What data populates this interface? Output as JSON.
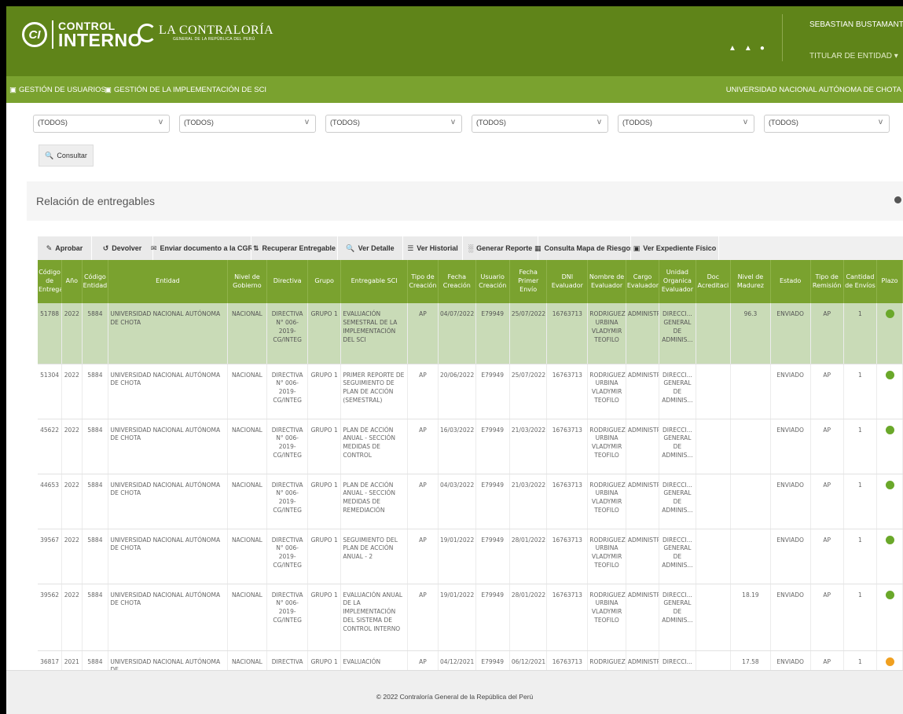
{
  "header": {
    "logo_ci_mark": "CI",
    "logo_line1": "CONTROL",
    "logo_line2": "INTERNO",
    "contraloria_name": "LA CONTRALORÍA",
    "contraloria_sub": "GENERAL DE LA REPÚBLICA DEL PERÚ",
    "user_name": "SEBASTIAN BUSTAMANTE EDQUEN",
    "user_role": "TITULAR DE ENTIDAD ▾",
    "icons": [
      "home-icon",
      "bell-icon",
      "user-icon"
    ]
  },
  "nav": {
    "gestion_usuarios": "GESTIÓN DE USUARIOS",
    "gestion_implementacion": "GESTIÓN DE LA IMPLEMENTACIÓN DE SCI",
    "entity": "UNIVERSIDAD NACIONAL AUTÓNOMA DE CHOTA"
  },
  "filters": [
    {
      "value": "(TODOS)"
    },
    {
      "value": "(TODOS)"
    },
    {
      "value": "(TODOS)"
    },
    {
      "value": "(TODOS)"
    },
    {
      "value": "(TODOS)"
    },
    {
      "value": "(TODOS)"
    }
  ],
  "consultar_label": "Consultar",
  "panel_title": "Relación de entregables",
  "toolbar": {
    "aprobar": "Aprobar",
    "devolver": "Devolver",
    "enviar": "Enviar documento a la CGR",
    "recuperar": "Recuperar Entregable",
    "ver_detalle": "Ver Detalle",
    "ver_historial": "Ver Historial",
    "generar_reporte": "Generar Reporte",
    "consulta_mapa": "Consulta Mapa de Riesgos",
    "ver_expediente": "Ver Expediente Físico"
  },
  "table": {
    "headers": [
      "Código de Entrega",
      "Año",
      "Código Entidad",
      "Entidad",
      "Nivel de Gobierno",
      "Directiva",
      "Grupo",
      "Entregable SCI",
      "Tipo de Creación",
      "Fecha Creación",
      "Usuario Creación",
      "Fecha Primer Envío",
      "DNI Evaluador",
      "Nombre de Evaluador",
      "Cargo Evaluador",
      "Unidad Organica Evaluador",
      "Doc Acreditaci",
      "Nivel de Madurez",
      "Estado",
      "Tipo de Remisión",
      "Cantidad de Envíos",
      "Plazo"
    ],
    "rows": [
      {
        "codigo": "51788",
        "anio": "2022",
        "cod_entidad": "5884",
        "entidad": "UNIVERSIDAD NACIONAL AUTÓNOMA DE CHOTA",
        "nivel": "NACIONAL",
        "directiva": "DIRECTIVA N° 006-2019-CG/INTEG",
        "grupo": "GRUPO 1",
        "entregable": "EVALUACIÓN SEMESTRAL DE LA IMPLEMENTACIÓN DEL SCI",
        "tipo_creacion": "AP",
        "fecha_creacion": "04/07/2022",
        "usuario": "E79949",
        "fecha_envio": "25/07/2022",
        "dni": "16763713",
        "nombre": "RODRIGUEZ URBINA VLADYMIR TEOFILO",
        "cargo": "ADMINISTR...",
        "unidad": "DIRECCI... GENERAL DE ADMINIS...",
        "doc": "",
        "madurez": "96.3",
        "estado": "ENVIADO",
        "remision": "AP",
        "envios": "1",
        "plazo_color": "#6aa82a"
      },
      {
        "codigo": "51304",
        "anio": "2022",
        "cod_entidad": "5884",
        "entidad": "UNIVERSIDAD NACIONAL AUTÓNOMA DE CHOTA",
        "nivel": "NACIONAL",
        "directiva": "DIRECTIVA N° 006-2019-CG/INTEG",
        "grupo": "GRUPO 1",
        "entregable": "PRIMER REPORTE DE SEGUIMIENTO DE PLAN DE ACCIÓN (SEMESTRAL)",
        "tipo_creacion": "AP",
        "fecha_creacion": "20/06/2022",
        "usuario": "E79949",
        "fecha_envio": "25/07/2022",
        "dni": "16763713",
        "nombre": "RODRIGUEZ URBINA VLADYMIR TEOFILO",
        "cargo": "ADMINISTR...",
        "unidad": "DIRECCI... GENERAL DE ADMINIS...",
        "doc": "",
        "madurez": "",
        "estado": "ENVIADO",
        "remision": "AP",
        "envios": "1",
        "plazo_color": "#6aa82a"
      },
      {
        "codigo": "45622",
        "anio": "2022",
        "cod_entidad": "5884",
        "entidad": "UNIVERSIDAD NACIONAL AUTÓNOMA DE CHOTA",
        "nivel": "NACIONAL",
        "directiva": "DIRECTIVA N° 006-2019-CG/INTEG",
        "grupo": "GRUPO 1",
        "entregable": "PLAN DE ACCIÓN ANUAL - SECCIÓN MEDIDAS DE CONTROL",
        "tipo_creacion": "AP",
        "fecha_creacion": "16/03/2022",
        "usuario": "E79949",
        "fecha_envio": "21/03/2022",
        "dni": "16763713",
        "nombre": "RODRIGUEZ URBINA VLADYMIR TEOFILO",
        "cargo": "ADMINISTR...",
        "unidad": "DIRECCI... GENERAL DE ADMINIS...",
        "doc": "",
        "madurez": "",
        "estado": "ENVIADO",
        "remision": "AP",
        "envios": "1",
        "plazo_color": "#6aa82a"
      },
      {
        "codigo": "44653",
        "anio": "2022",
        "cod_entidad": "5884",
        "entidad": "UNIVERSIDAD NACIONAL AUTÓNOMA DE CHOTA",
        "nivel": "NACIONAL",
        "directiva": "DIRECTIVA N° 006-2019-CG/INTEG",
        "grupo": "GRUPO 1",
        "entregable": "PLAN DE ACCIÓN ANUAL - SECCIÓN MEDIDAS DE REMEDIACIÓN",
        "tipo_creacion": "AP",
        "fecha_creacion": "04/03/2022",
        "usuario": "E79949",
        "fecha_envio": "21/03/2022",
        "dni": "16763713",
        "nombre": "RODRIGUEZ URBINA VLADYMIR TEOFILO",
        "cargo": "ADMINISTR...",
        "unidad": "DIRECCI... GENERAL DE ADMINIS...",
        "doc": "",
        "madurez": "",
        "estado": "ENVIADO",
        "remision": "AP",
        "envios": "1",
        "plazo_color": "#6aa82a"
      },
      {
        "codigo": "39567",
        "anio": "2022",
        "cod_entidad": "5884",
        "entidad": "UNIVERSIDAD NACIONAL AUTÓNOMA DE CHOTA",
        "nivel": "NACIONAL",
        "directiva": "DIRECTIVA N° 006-2019-CG/INTEG",
        "grupo": "GRUPO 1",
        "entregable": "SEGUIMIENTO DEL PLAN DE ACCIÓN ANUAL - 2",
        "tipo_creacion": "AP",
        "fecha_creacion": "19/01/2022",
        "usuario": "E79949",
        "fecha_envio": "28/01/2022",
        "dni": "16763713",
        "nombre": "RODRIGUEZ URBINA VLADYMIR TEOFILO",
        "cargo": "ADMINISTR...",
        "unidad": "DIRECCI... GENERAL DE ADMINIS...",
        "doc": "",
        "madurez": "",
        "estado": "ENVIADO",
        "remision": "AP",
        "envios": "1",
        "plazo_color": "#6aa82a"
      },
      {
        "codigo": "39562",
        "anio": "2022",
        "cod_entidad": "5884",
        "entidad": "UNIVERSIDAD NACIONAL AUTÓNOMA DE CHOTA",
        "nivel": "NACIONAL",
        "directiva": "DIRECTIVA N° 006-2019-CG/INTEG",
        "grupo": "GRUPO 1",
        "entregable": "EVALUACIÓN ANUAL DE LA IMPLEMENTACIÓN DEL SISTEMA DE CONTROL INTERNO",
        "tipo_creacion": "AP",
        "fecha_creacion": "19/01/2022",
        "usuario": "E79949",
        "fecha_envio": "28/01/2022",
        "dni": "16763713",
        "nombre": "RODRIGUEZ URBINA VLADYMIR TEOFILO",
        "cargo": "ADMINISTR...",
        "unidad": "DIRECCI... GENERAL DE ADMINIS...",
        "doc": "",
        "madurez": "18.19",
        "estado": "ENVIADO",
        "remision": "AP",
        "envios": "1",
        "plazo_color": "#6aa82a"
      },
      {
        "codigo": "36817",
        "anio": "2021",
        "cod_entidad": "5884",
        "entidad": "UNIVERSIDAD NACIONAL AUTÓNOMA DE",
        "nivel": "NACIONAL",
        "directiva": "DIRECTIVA",
        "grupo": "GRUPO 1",
        "entregable": "EVALUACIÓN",
        "tipo_creacion": "AP",
        "fecha_creacion": "04/12/2021",
        "usuario": "E79949",
        "fecha_envio": "06/12/2021",
        "dni": "16763713",
        "nombre": "RODRIGUEZ",
        "cargo": "ADMINISTR...",
        "unidad": "DIRECCI...",
        "doc": "",
        "madurez": "17.58",
        "estado": "ENVIADO",
        "remision": "AP",
        "envios": "1",
        "plazo_color": "#f0a020"
      }
    ]
  },
  "footer": "© 2022 Contraloría General de la República del Perú"
}
